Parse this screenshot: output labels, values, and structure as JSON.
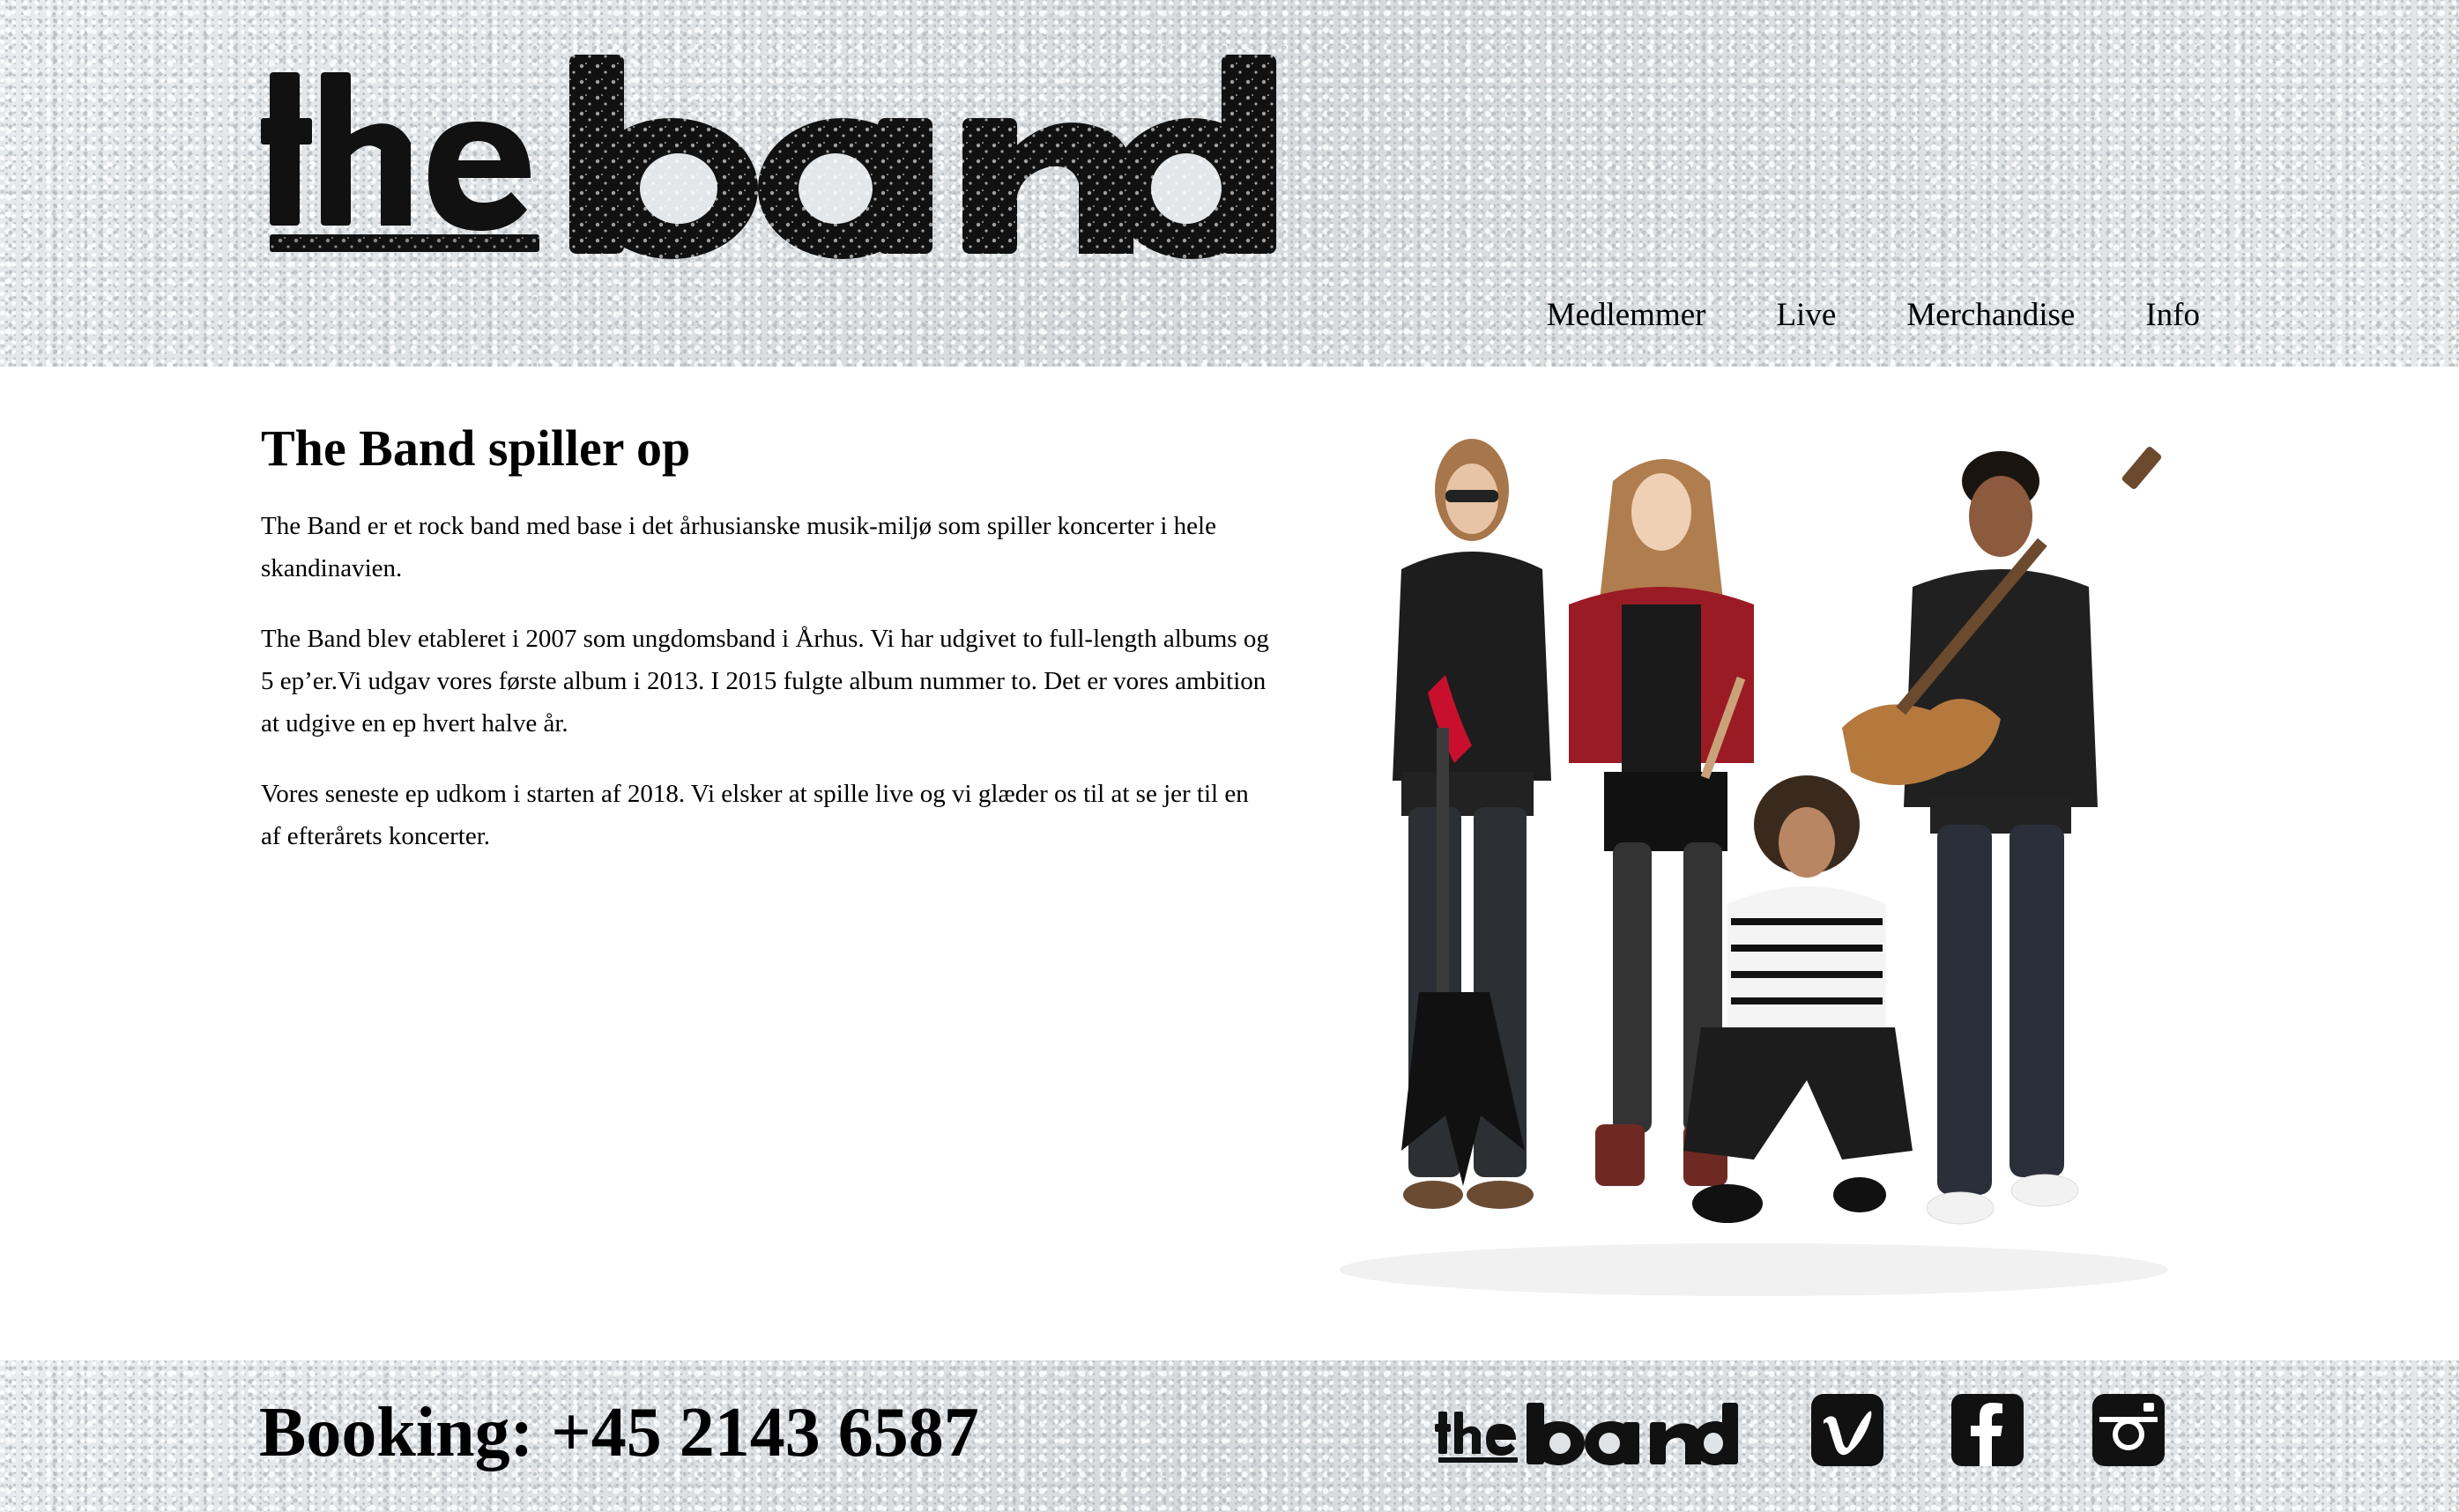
{
  "header": {
    "logo_text": "the band",
    "nav": [
      {
        "label": "Medlemmer"
      },
      {
        "label": "Live"
      },
      {
        "label": "Merchandise"
      },
      {
        "label": "Info"
      }
    ]
  },
  "main": {
    "title": "The Band spiller op",
    "paragraphs": [
      "The Band er et rock band med base i det århusianske musik-miljø som spiller koncerter i hele skandinavien.",
      "The Band blev etableret i 2007 som ungdomsband i Århus. Vi har udgivet to full-length albums og 5 ep’er.Vi udgav vores første album i 2013. I 2015 fulgte album nummer to. Det er vores ambition at udgive en ep hvert halve år.",
      "Vores seneste ep udkom i starten af 2018. Vi elsker at spille live og vi glæder os til at se jer til en af efterårets koncerter."
    ]
  },
  "footer": {
    "booking": "Booking: +45 2143 6587",
    "logo_text": "the band",
    "social_icons": [
      "vimeo-icon",
      "facebook-icon",
      "instagram-icon"
    ]
  },
  "colors": {
    "text": "#000000",
    "background": "#ffffff",
    "texture": "#dfe3e5"
  }
}
